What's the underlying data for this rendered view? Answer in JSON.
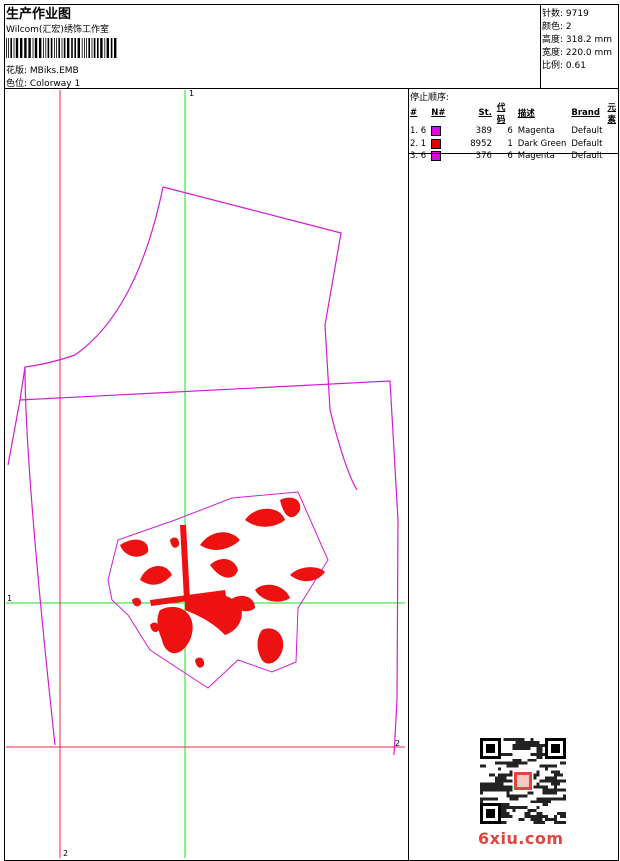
{
  "header": {
    "title": "生产作业图",
    "studio": "Wilcom(汇宏)绣饰工作室",
    "design": "花版: MBiks.EMB",
    "colorway": "色位: Colorway 1"
  },
  "stats": [
    {
      "label": "针数: 9719"
    },
    {
      "label": "颜色: 2"
    },
    {
      "label": "高度: 318.2 mm"
    },
    {
      "label": "宽度: 220.0 mm"
    },
    {
      "label": "比例: 0.61"
    }
  ],
  "sequence": {
    "title": "停止顺序:",
    "headers": [
      "#",
      "N#",
      "St.",
      "代码",
      "描述",
      "Brand",
      "元素"
    ],
    "rows": [
      {
        "idx": "1. 6",
        "swatch": "#e600e6",
        "stitches": "389",
        "code": "6",
        "desc": "Magenta",
        "brand": "Default"
      },
      {
        "idx": "2. 1",
        "swatch": "#e00000",
        "stitches": "8952",
        "code": "1",
        "desc": "Dark Green",
        "brand": "Default"
      },
      {
        "idx": "3. 6",
        "swatch": "#e600e6",
        "stitches": "376",
        "code": "6",
        "desc": "Magenta",
        "brand": "Default"
      }
    ]
  },
  "guides": {
    "v_green": "1",
    "h_green": "1",
    "v_red": "2",
    "h_red": "2"
  },
  "colors": {
    "outline": "#d21dd2",
    "embroidery": "#ee1111",
    "guide_green": "#22dd22",
    "guide_red": "#e02a4a",
    "watermark": "#e0453f"
  },
  "watermark": {
    "site": "6xiu.com"
  }
}
